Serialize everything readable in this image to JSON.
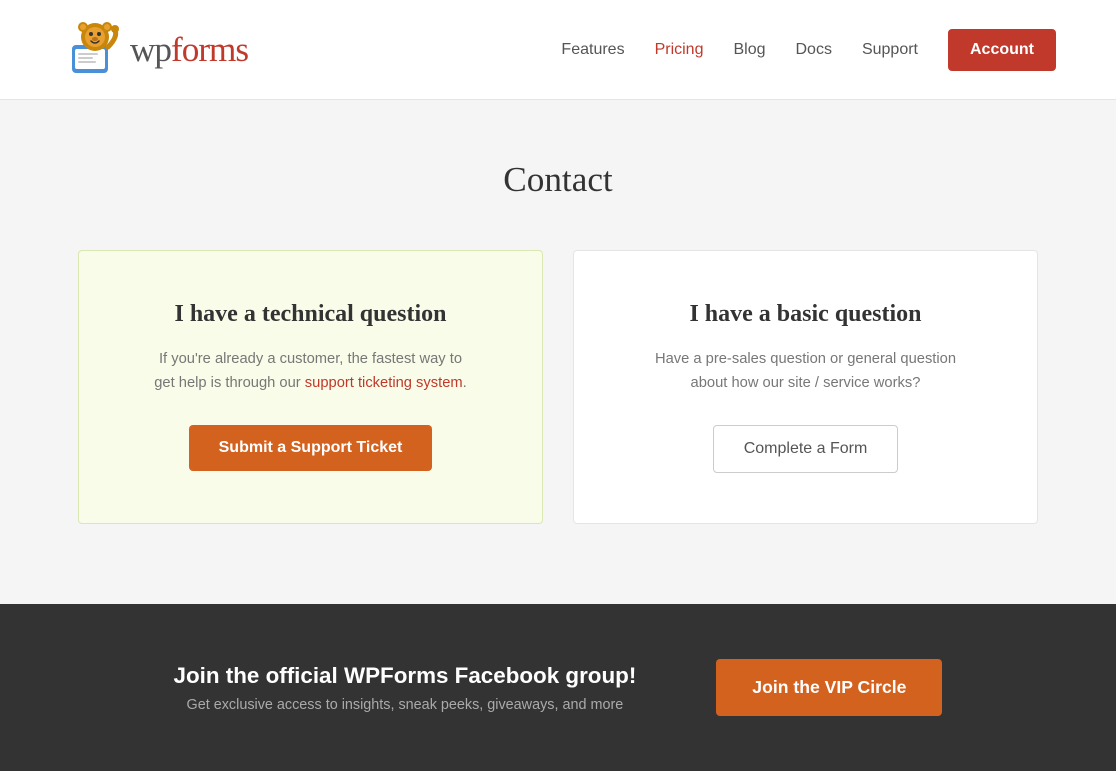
{
  "header": {
    "logo_text": "wpforms",
    "nav": {
      "items": [
        {
          "label": "Features",
          "active": false
        },
        {
          "label": "Pricing",
          "active": true
        },
        {
          "label": "Blog",
          "active": false
        },
        {
          "label": "Docs",
          "active": false
        },
        {
          "label": "Support",
          "active": false
        }
      ],
      "account_button": "Account"
    }
  },
  "main": {
    "page_title": "Contact",
    "cards": [
      {
        "id": "technical",
        "title": "I have a technical question",
        "description": "If you're already a customer, the fastest way to get help is through our support ticketing system.",
        "button_label": "Submit a Support Ticket",
        "highlight": true,
        "button_type": "primary"
      },
      {
        "id": "basic",
        "title": "I have a basic question",
        "description": "Have a pre-sales question or general question about how our site / service works?",
        "button_label": "Complete a Form",
        "highlight": false,
        "button_type": "secondary"
      }
    ]
  },
  "footer": {
    "title": "Join the official WPForms Facebook group!",
    "subtitle": "Get exclusive access to insights, sneak peeks, giveaways, and more",
    "vip_button": "Join the VIP Circle"
  }
}
